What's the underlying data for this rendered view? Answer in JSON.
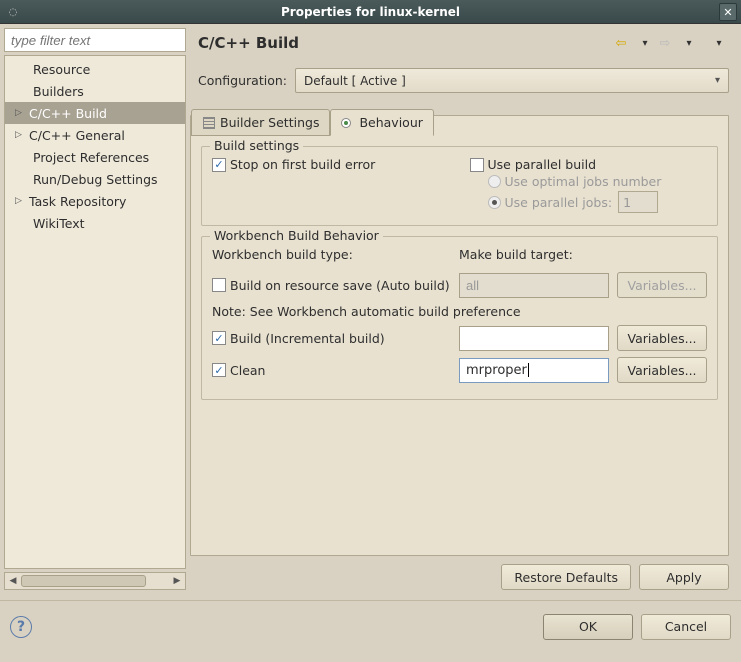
{
  "window": {
    "title": "Properties for linux-kernel"
  },
  "sidebar": {
    "filter_placeholder": "type filter text",
    "items": [
      {
        "label": "Resource",
        "expander": "",
        "indent": true
      },
      {
        "label": "Builders",
        "expander": "",
        "indent": true
      },
      {
        "label": "C/C++ Build",
        "expander": "▷",
        "selected": true
      },
      {
        "label": "C/C++ General",
        "expander": "▷"
      },
      {
        "label": "Project References",
        "expander": "",
        "indent": true
      },
      {
        "label": "Run/Debug Settings",
        "expander": "",
        "indent": true
      },
      {
        "label": "Task Repository",
        "expander": "▷"
      },
      {
        "label": "WikiText",
        "expander": "",
        "indent": true
      }
    ]
  },
  "page": {
    "title": "C/C++ Build",
    "config_label": "Configuration:",
    "config_value": "Default  [ Active ]"
  },
  "tabs": {
    "builder": "Builder Settings",
    "behaviour": "Behaviour"
  },
  "build_settings": {
    "group_title": "Build settings",
    "stop_first": "Stop on first build error",
    "stop_first_checked": true,
    "use_parallel": "Use parallel build",
    "use_parallel_checked": false,
    "optimal": "Use optimal jobs number",
    "parallel_jobs": "Use parallel jobs:",
    "jobs_value": "1"
  },
  "workbench": {
    "group_title": "Workbench Build Behavior",
    "type_header": "Workbench build type:",
    "target_header": "Make build target:",
    "auto_build_label": "Build on resource save (Auto build)",
    "auto_build_checked": false,
    "auto_build_target": "all",
    "note": "Note: See Workbench automatic build preference",
    "incremental_label": "Build (Incremental build)",
    "incremental_checked": true,
    "incremental_target": "",
    "clean_label": "Clean",
    "clean_checked": true,
    "clean_target": "mrproper",
    "variables_btn": "Variables..."
  },
  "buttons": {
    "restore": "Restore Defaults",
    "apply": "Apply",
    "ok": "OK",
    "cancel": "Cancel"
  }
}
